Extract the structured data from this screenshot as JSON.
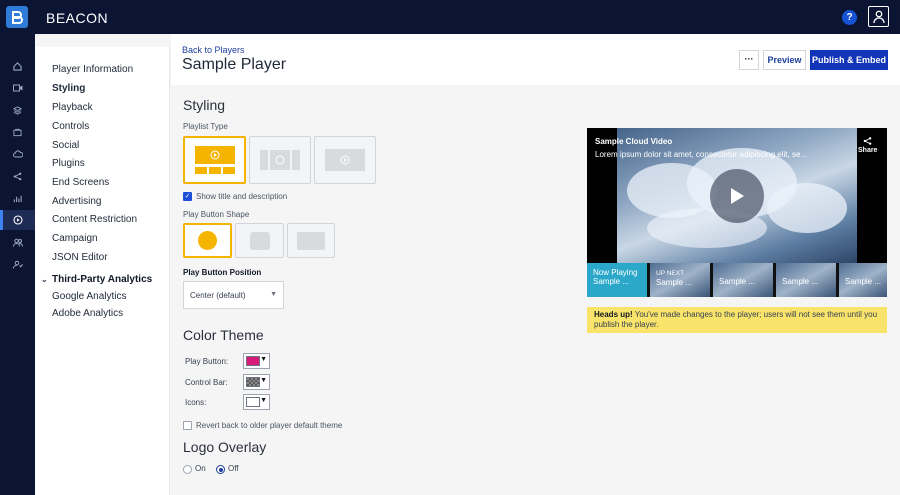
{
  "app": {
    "brand": "BEACON",
    "help_label": "?"
  },
  "rail": {
    "icons": [
      "home-icon",
      "video-icon",
      "layers-icon",
      "folder-icon",
      "cloud-icon",
      "share-icon",
      "analytics-icon",
      "players-icon",
      "users-icon",
      "user-settings-icon"
    ]
  },
  "subnav": {
    "items": [
      "Player Information",
      "Styling",
      "Playback",
      "Controls",
      "Social",
      "Plugins",
      "End Screens",
      "Advertising",
      "Content Restriction",
      "Campaign",
      "JSON Editor"
    ],
    "active": "Styling",
    "group_label": "Third-Party Analytics",
    "group_items": [
      "Google Analytics",
      "Adobe Analytics"
    ]
  },
  "header": {
    "back_label": "Back to Players",
    "title": "Sample Player",
    "more_label": "···",
    "preview_label": "Preview",
    "publish_label": "Publish & Embed"
  },
  "styling": {
    "title": "Styling",
    "playlist_type_label": "Playlist Type",
    "show_title_label": "Show title and description",
    "show_title_checked": true,
    "play_shape_label": "Play Button Shape",
    "play_position_label": "Play Button Position",
    "play_position_value": "Center (default)",
    "play_position_arrow": "▼"
  },
  "color_theme": {
    "title": "Color Theme",
    "play_button_label": "Play Button:",
    "control_bar_label": "Control Bar:",
    "icons_label": "Icons:",
    "play_button_color": "#d81b7a",
    "control_bar_color": "#6b6b6b",
    "icons_color": "#ffffff",
    "revert_label": "Revert back to older player default theme"
  },
  "logo_overlay": {
    "title": "Logo Overlay",
    "on_label": "On",
    "off_label": "Off",
    "selected": "Off"
  },
  "preview": {
    "video_title": "Sample Cloud Video",
    "video_desc": "Lorem ipsum dolor sit amet, consectetur adipiscing elit, se...",
    "share_label": "Share",
    "playlist": [
      {
        "top": "Now Playing",
        "bottom": "Sample ..."
      },
      {
        "top": "UP NEXT",
        "bottom": "Sample ..."
      },
      {
        "top": "",
        "bottom": "Sample ..."
      },
      {
        "top": "",
        "bottom": "Sample ..."
      },
      {
        "top": "",
        "bottom": "Sample ..."
      }
    ]
  },
  "notice": {
    "lead": "Heads up!",
    "text": " You've made changes to the player; users will not see them until you publish the player."
  },
  "colors": {
    "accent": "#f5b400",
    "publish": "#1234b8",
    "topbar": "#0b1533",
    "notice": "#f8e36b"
  }
}
